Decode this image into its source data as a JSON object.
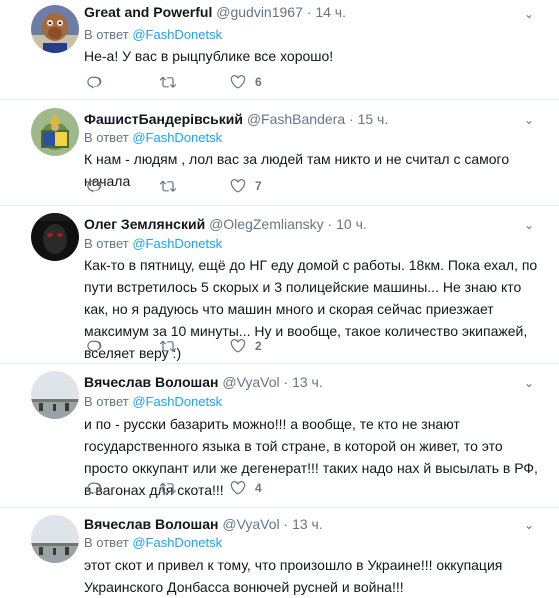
{
  "tweets": [
    {
      "name": "Great and Powerful",
      "handle": "@gudvin1967",
      "time": "14 ч.",
      "reply_prefix": "В ответ",
      "reply_to": "@FashDonetsk",
      "text": "Не-а! У вас в рыцпублике все хорошо!",
      "likes": "6",
      "replies": "",
      "retweets": "",
      "avatar": "alf-avatar"
    },
    {
      "name": "ФашистБандерівський",
      "handle": "@FashBandera",
      "time": "15 ч.",
      "reply_prefix": "В ответ",
      "reply_to": "@FashDonetsk",
      "text": "К нам - людям , лол вас за людей там никто и не считал с самого начала",
      "likes": "7",
      "replies": "",
      "retweets": "",
      "avatar": "ukraine-avatar"
    },
    {
      "name": "Олег Землянский",
      "handle": "@OlegZemliansky",
      "time": "10 ч.",
      "reply_prefix": "В ответ",
      "reply_to": "@FashDonetsk",
      "text": "Как-то в пятницу, ещё до НГ еду домой с работы. 18км. Пока ехал, по пути встретилось 5 скорых и 3 полицейские машины... Не знаю кто как, но я радуюсь что машин много и скорая сейчас приезжает максимум за 10 минуты... Ну и вообще, такое количество экипажей, вселяет веру :)",
      "likes": "2",
      "replies": "",
      "retweets": "",
      "avatar": "dark-avatar"
    },
    {
      "name": "Вячеслав Волошан",
      "handle": "@VyaVol",
      "time": "13 ч.",
      "reply_prefix": "В ответ",
      "reply_to": "@FashDonetsk",
      "text": "и по - русски базарить можно!!! а вообще, те кто не знают государственного языка в той стране, в которой он живет, то это просто оккупант или же дегенерат!!! таких надо нах   й высылать в РФ, в вагонах для скота!!!",
      "likes": "4",
      "replies": "",
      "retweets": "",
      "avatar": "landscape-avatar"
    },
    {
      "name": "Вячеслав Волошан",
      "handle": "@VyaVol",
      "time": "13 ч.",
      "reply_prefix": "В ответ",
      "reply_to": "@FashDonetsk",
      "text": "этот скот и привел к тому, что произошло в Украине!!! оккупация Украинского Донбасса вонючей русней и война!!!",
      "likes": "",
      "replies": "",
      "retweets": "",
      "avatar": "landscape-avatar"
    }
  ],
  "colors": {
    "link": "#1da1f2",
    "meta": "#657786",
    "text": "#14171a",
    "divider": "#e6ecf0"
  },
  "icons": [
    "reply-icon",
    "retweet-icon",
    "like-icon",
    "chevron-down-icon"
  ]
}
